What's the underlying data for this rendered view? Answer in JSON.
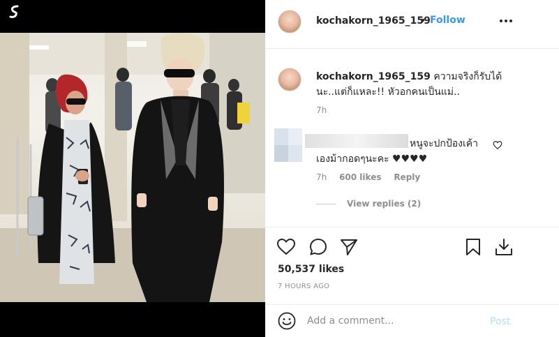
{
  "header": {
    "username": "kochakorn_1965_159",
    "separator": "•",
    "follow_label": "Follow",
    "more_icon": "more-horizontal-icon"
  },
  "caption": {
    "username": "kochakorn_1965_159",
    "text": "ความจริงก็รับได้นะ..แต่ก็แหละ!! หัวอกคนเป็นแม่..",
    "time": "7h"
  },
  "comment": {
    "text": "หนูจะปกป้องเค้าเองม้ากอดๆนะคะ ♥♥♥♥",
    "time": "7h",
    "likes": "600 likes",
    "reply_label": "Reply",
    "view_replies": "View replies (2)"
  },
  "post": {
    "likes": "50,537 likes",
    "time_ago": "7 HOURS AGO"
  },
  "add_comment": {
    "placeholder": "Add a comment...",
    "post_label": "Post"
  },
  "colors": {
    "link_blue": "#3897f0",
    "post_disabled": "#b2dffc",
    "muted": "#8e8e8e",
    "text": "#262626"
  }
}
